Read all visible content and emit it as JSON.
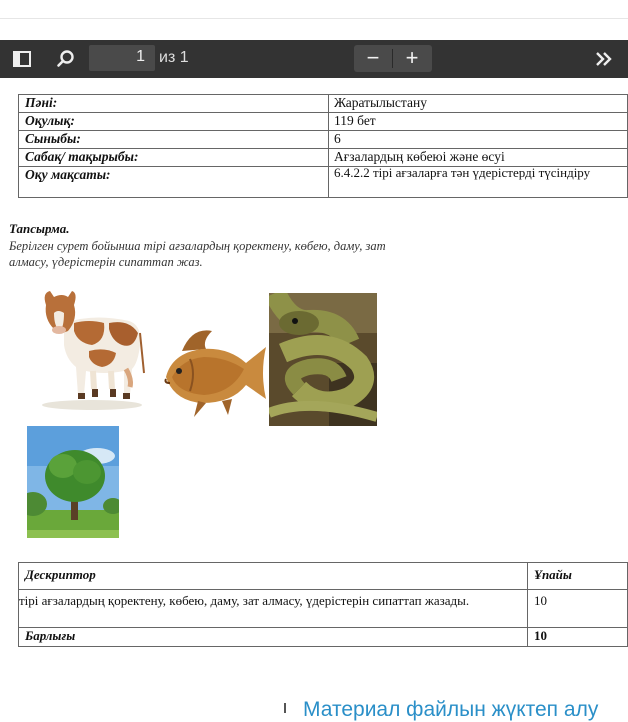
{
  "viewer": {
    "page_number": "1",
    "page_of": "из 1",
    "zoom_out_label": "−",
    "zoom_in_label": "+",
    "more_label": "»",
    "icons": [
      "sidebar-toggle-icon",
      "search-icon",
      "chevron-double-right-icon"
    ]
  },
  "info_table": [
    {
      "key": "Пәні:",
      "value": "Жаратылыстану"
    },
    {
      "key": "Оқулық:",
      "value": "119 бет"
    },
    {
      "key": "Сыныбы:",
      "value": "6"
    },
    {
      "key": "Сабақ/ тақырыбы:",
      "value": " Ағзалардың көбеюі және өсуі"
    },
    {
      "key": "Оқу мақсаты:",
      "value": "6.4.2.2 тірі ағзаларға тән  үдерістерді түсіндіру"
    }
  ],
  "task": {
    "title": "Тапсырма.",
    "text": " Берілген сурет бойынша тірі ағзалардың қоректену, көбею, даму, зат алмасу, үдерістерін сипаттап жаз."
  },
  "images": [
    "cow",
    "fish",
    "snake",
    "tree"
  ],
  "descriptor_table": {
    "header": {
      "col1": "Дескриптор",
      "col2": "Ұпайы"
    },
    "row": {
      "col1": "тірі ағзалардың қоректену, көбею, даму, зат алмасу, үдерістерін сипаттап жазады.",
      "col2": "10"
    },
    "footer": {
      "col1": "Барлығы",
      "col2": "10"
    }
  },
  "bottom_link": "Материал файлын жүктеп алу"
}
